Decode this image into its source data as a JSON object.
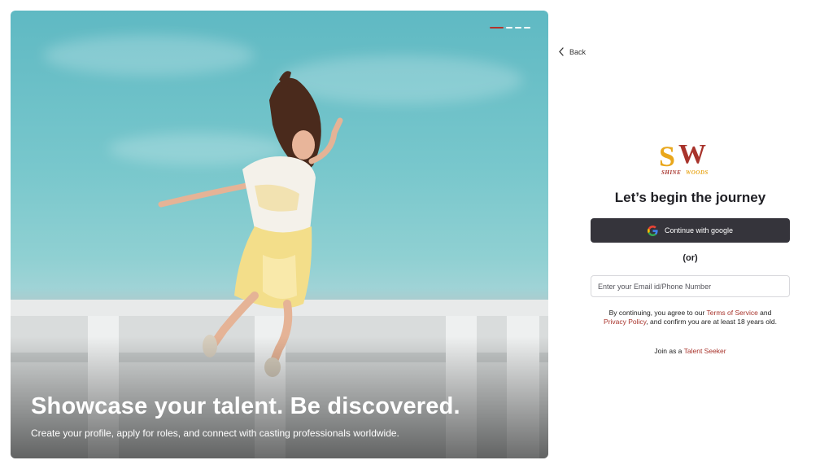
{
  "hero": {
    "title": "Showcase your talent. Be discovered.",
    "subtitle": "Create your profile, apply for roles, and connect with casting professionals worldwide.",
    "carousel": {
      "slides": 4,
      "active_index": 0,
      "active_color": "#b3332b"
    }
  },
  "nav": {
    "back_label": "Back",
    "back_icon": "chevron-left-icon"
  },
  "brand": {
    "logo_letters": "SW",
    "logo_word": "SHINEWOODS",
    "colors": {
      "gold": "#e9a71c",
      "red": "#a8332b"
    }
  },
  "auth": {
    "heading": "Let’s begin the journey",
    "google_button_label": "Continue with google",
    "google_icon": "google-icon",
    "or_label": "(or)",
    "email_placeholder": "Enter your Email id/Phone Number",
    "terms_prefix": "By continuing, you agree to our ",
    "terms_link": "Terms of Service",
    "terms_and": " and ",
    "privacy_link": "Privacy Policy",
    "terms_suffix": ", and confirm you are at least 18 years old.",
    "join_prefix": "Join as a ",
    "join_link": "Talent Seeker",
    "accent_color": "#a8332b",
    "button_color": "#35343b"
  }
}
